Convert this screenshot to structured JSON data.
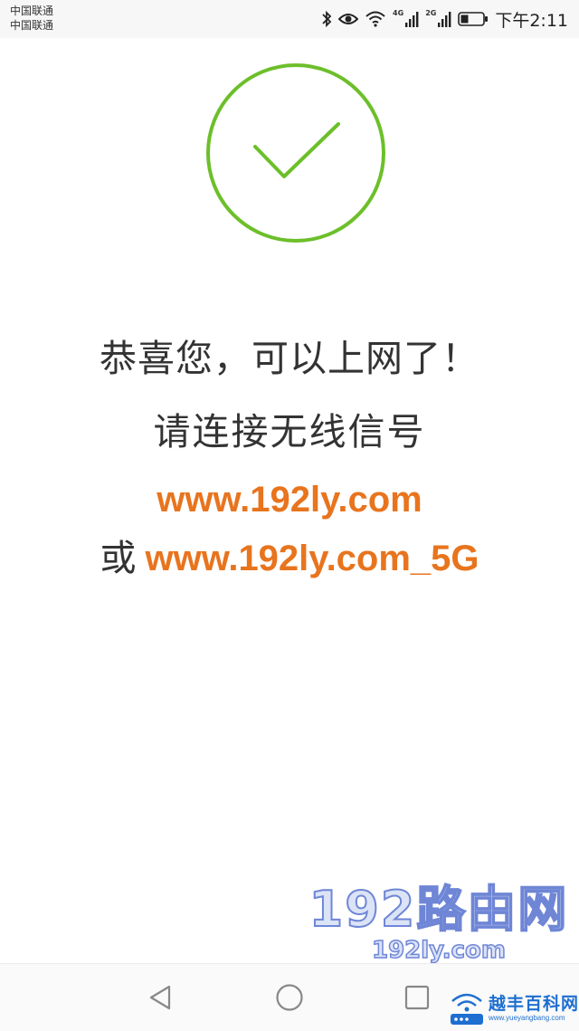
{
  "status_bar": {
    "carrier_1": "中国联通",
    "carrier_2": "中国联通",
    "network_1": "4G",
    "network_2": "2G",
    "time": "下午2:11",
    "icons": [
      "bluetooth-icon",
      "eye-comfort-icon",
      "wifi-icon",
      "signal-icon",
      "signal-icon",
      "battery-icon"
    ]
  },
  "success": {
    "icon": "check-circle-icon",
    "icon_color": "#6cbf2a",
    "title": "恭喜您，可以上网了！",
    "subtitle": "请连接无线信号",
    "ssid_primary": "www.192ly.com",
    "or_label": "或",
    "ssid_5g": "www.192ly.com_5G",
    "ssid_color": "#e8741e"
  },
  "watermark": {
    "brand": "192路由网",
    "domain": "192ly.com"
  },
  "nav_bar": {
    "back": "back-triangle-icon",
    "home": "home-circle-icon",
    "recent": "recent-square-icon"
  },
  "corner_logo": {
    "text": "越丰百科网",
    "url": "www.yueyangbang.com"
  }
}
